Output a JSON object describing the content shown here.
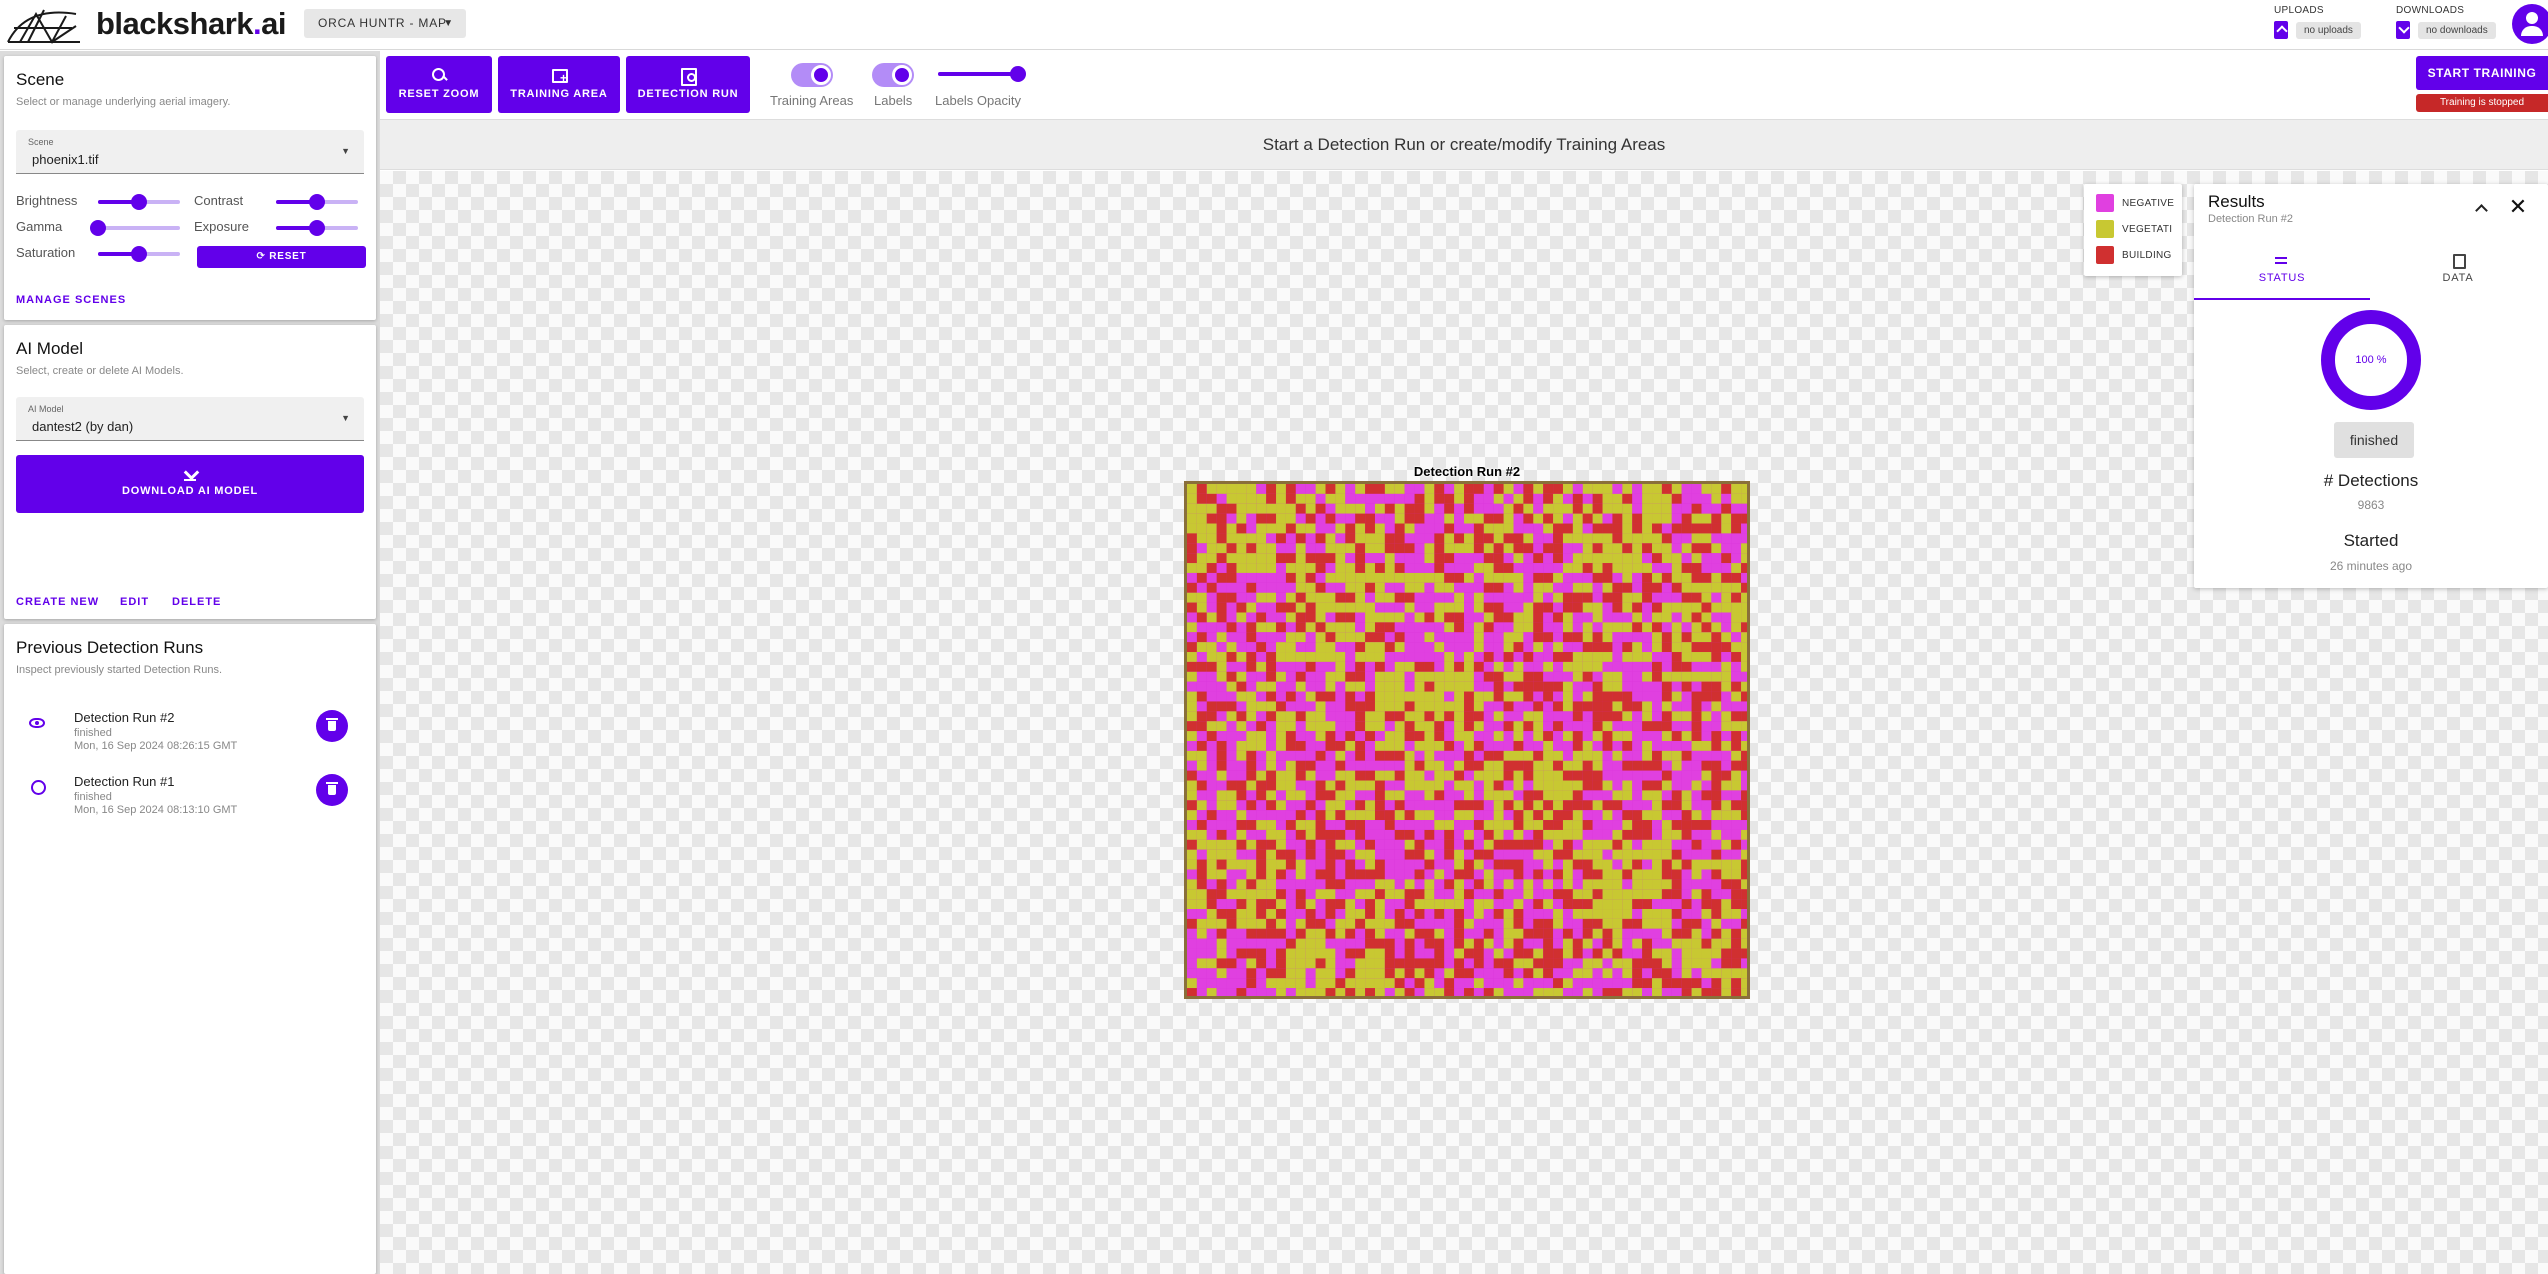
{
  "header": {
    "logo_text": "blackshark.ai",
    "project_select": "ORCA HUNTR - MAP",
    "uploads": {
      "label": "UPLOADS",
      "value": "no uploads"
    },
    "downloads": {
      "label": "DOWNLOADS",
      "value": "no downloads"
    }
  },
  "scene_panel": {
    "title": "Scene",
    "subtitle": "Select or manage underlying aerial imagery.",
    "field_label": "Scene",
    "selected": "phoenix1.tif",
    "sliders": [
      {
        "label": "Brightness",
        "value": 0.5
      },
      {
        "label": "Contrast",
        "value": 0.5
      },
      {
        "label": "Gamma",
        "value": 0.0
      },
      {
        "label": "Exposure",
        "value": 0.5
      },
      {
        "label": "Saturation",
        "value": 0.5
      }
    ],
    "reset_label": "RESET",
    "manage_label": "MANAGE SCENES"
  },
  "model_panel": {
    "title": "AI Model",
    "subtitle": "Select, create or delete AI Models.",
    "field_label": "AI Model",
    "selected": "dantest2 (by dan)",
    "download_label": "DOWNLOAD AI MODEL",
    "create_label": "CREATE NEW",
    "edit_label": "EDIT",
    "delete_label": "DELETE"
  },
  "runs_panel": {
    "title": "Previous Detection Runs",
    "subtitle": "Inspect previously started Detection Runs.",
    "runs": [
      {
        "name": "Detection Run #2",
        "status": "finished",
        "time": "Mon, 16 Sep 2024 08:26:15 GMT"
      },
      {
        "name": "Detection Run #1",
        "status": "finished",
        "time": "Mon, 16 Sep 2024 08:13:10 GMT"
      }
    ]
  },
  "toolbar": {
    "reset_zoom": "RESET ZOOM",
    "training_area": "TRAINING AREA",
    "detection_run": "DETECTION RUN",
    "training_areas_label": "Training Areas",
    "labels_label": "Labels",
    "labels_opacity_label": "Labels Opacity",
    "labels_opacity_value": 1.0,
    "start_training": "START TRAINING",
    "training_status": "Training is stopped"
  },
  "status_message": "Start a Detection Run or create/modify Training Areas",
  "map": {
    "raster_title": "Detection Run #2"
  },
  "legend": [
    {
      "label": "NEGATIVE",
      "color": "#e040e0"
    },
    {
      "label": "VEGETATI",
      "color": "#c8c832"
    },
    {
      "label": "BUILDING",
      "color": "#d03030"
    }
  ],
  "results": {
    "title": "Results",
    "subtitle": "Detection Run #2",
    "tab_status": "STATUS",
    "tab_data": "DATA",
    "progress": "100 %",
    "status": "finished",
    "detections_label": "# Detections",
    "detections_value": "9863",
    "started_label": "Started",
    "started_value": "26 minutes ago"
  },
  "colors": {
    "accent": "#6200ea",
    "error": "#c62828"
  }
}
